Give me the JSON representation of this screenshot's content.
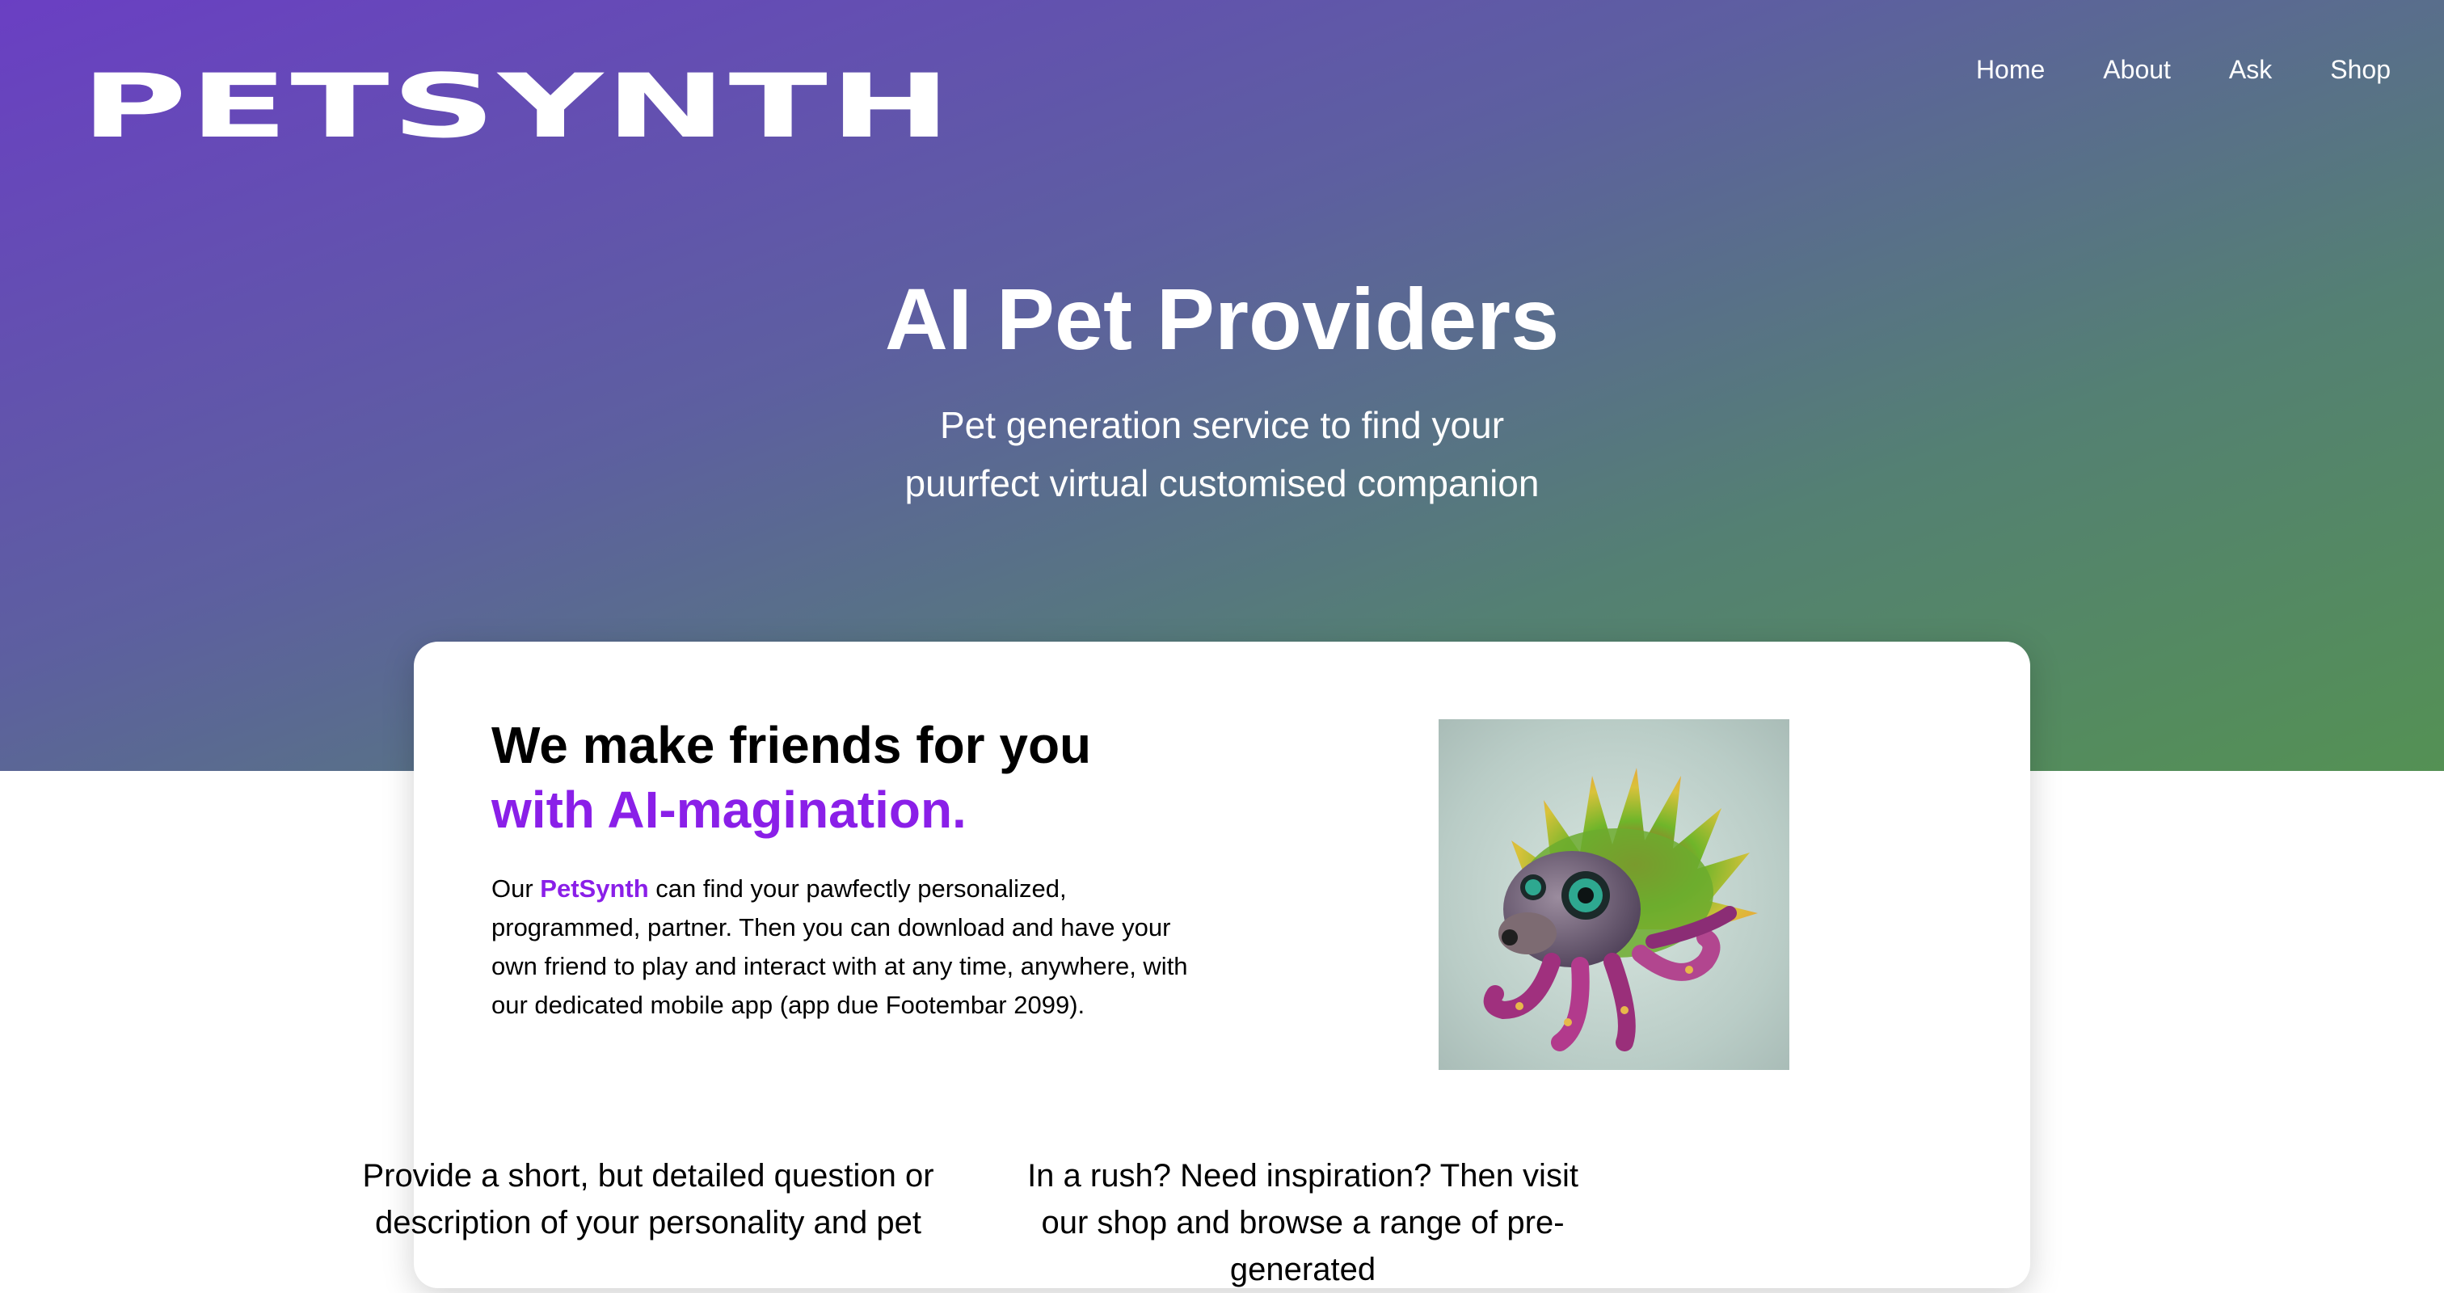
{
  "header": {
    "logo": "PETSYNTH",
    "nav": [
      "Home",
      "About",
      "Ask",
      "Shop"
    ]
  },
  "hero": {
    "title": "AI Pet Providers",
    "subtitle": "Pet generation service to find your puurfect virtual customised companion"
  },
  "intro": {
    "heading_line1": "We make friends for you",
    "heading_line2": "with AI-magination.",
    "body_prefix": "Our ",
    "body_brand": "PetSynth",
    "body_rest": " can find your pawfectly personalized, programmed, partner. Then you can download and have your own friend to play and interact with at any time, anywhere, with our dedicated mobile app (app due Footembar 2099)."
  },
  "columns": {
    "left": "Provide a short, but detailed question or description of your personality and pet",
    "right": "In a rush? Need inspiration? Then visit our shop and browse a range of pre-generated"
  },
  "colors": {
    "accent": "#8a1fe8",
    "hero_gradient_start": "#6a3fc3",
    "hero_gradient_end": "#549154"
  },
  "image": {
    "icon": "pet-octopus-hedgehog-illustration"
  }
}
